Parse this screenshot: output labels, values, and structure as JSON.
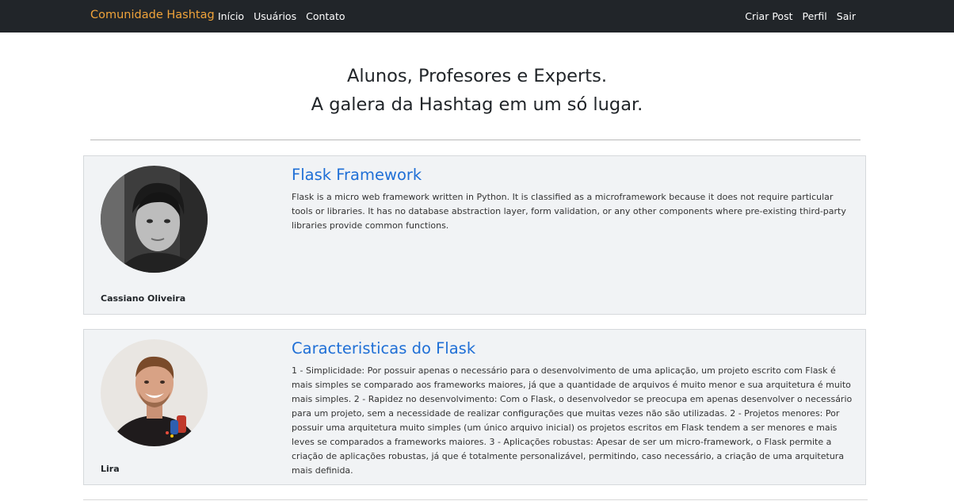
{
  "navbar": {
    "brand": "Comunidade Hashtag",
    "left_links": [
      "Início",
      "Usuários",
      "Contato"
    ],
    "right_links": [
      "Criar Post",
      "Perfil",
      "Sair"
    ]
  },
  "hero": {
    "line1": "Alunos, Profesores e Experts.",
    "line2": "A galera da Hashtag em um só lugar."
  },
  "posts": [
    {
      "author": "Cassiano Oliveira",
      "title": "Flask Framework",
      "body": "Flask is a micro web framework written in Python. It is classified as a microframework because it does not require particular tools or libraries. It has no database abstraction layer, form validation, or any other components where pre-existing third-party libraries provide common functions.",
      "avatar_icon": "user-photo-grayscale"
    },
    {
      "author": "Lira",
      "title": "Caracteristicas do Flask",
      "body": "1 - Simplicidade: Por possuir apenas o necessário para o desenvolvimento de uma aplicação, um projeto escrito com Flask é mais simples se comparado aos frameworks maiores, já que a quantidade de arquivos é muito menor e sua arquitetura é muito mais simples. 2 - Rapidez no desenvolvimento: Com o Flask, o desenvolvedor se preocupa em apenas desenvolver o necessário para um projeto, sem a necessidade de realizar configurações que muitas vezes não são utilizadas. 2 - Projetos menores: Por possuir uma arquitetura muito simples (um único arquivo inicial) os projetos escritos em Flask tendem a ser menores e mais leves se comparados a frameworks maiores. 3 - Aplicações robustas: Apesar de ser um micro-framework, o Flask permite a criação de aplicações robustas, já que é totalmente personalizável, permitindo, caso necessário, a criação de uma arquitetura mais definida.",
      "avatar_icon": "user-photo-color"
    }
  ],
  "colors": {
    "navbar_bg": "#212529",
    "brand": "#f0a33a",
    "link_title": "#1f6fd6",
    "card_bg": "#f1f3f5"
  }
}
